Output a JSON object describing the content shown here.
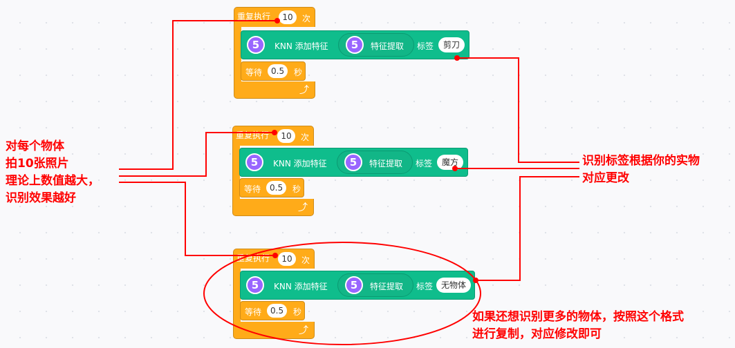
{
  "blocks": [
    {
      "repeat_label": "重复执行",
      "repeat_count": "10",
      "times_label": "次",
      "knn_label": "KNN 添加特征",
      "badge": "5",
      "extract_label": "特征提取",
      "tag_label": "标签",
      "tag_value": "剪刀",
      "wait_label": "等待",
      "wait_value": "0.5",
      "seconds_label": "秒"
    },
    {
      "repeat_label": "重复执行",
      "repeat_count": "10",
      "times_label": "次",
      "knn_label": "KNN 添加特征",
      "badge": "5",
      "extract_label": "特征提取",
      "tag_label": "标签",
      "tag_value": "魔方",
      "wait_label": "等待",
      "wait_value": "0.5",
      "seconds_label": "秒"
    },
    {
      "repeat_label": "重复执行",
      "repeat_count": "10",
      "times_label": "次",
      "knn_label": "KNN 添加特征",
      "badge": "5",
      "extract_label": "特征提取",
      "tag_label": "标签",
      "tag_value": "无物体",
      "wait_label": "等待",
      "wait_value": "0.5",
      "seconds_label": "秒"
    }
  ],
  "annotations": {
    "left": [
      "对每个物体",
      "拍10张照片",
      "理论上数值越大，",
      "识别效果越好"
    ],
    "right": [
      "识别标签根据你的实物",
      "对应更改"
    ],
    "bottom": [
      "如果还想识别更多的物体，按照这个格式",
      "进行复制，对应修改即可"
    ]
  },
  "colors": {
    "control": "#ffab19",
    "extension": "#0fbd8c",
    "badge": "#9966ff",
    "annotation": "#ff0000"
  },
  "icons": {
    "loop": "loop-arrow-icon"
  }
}
